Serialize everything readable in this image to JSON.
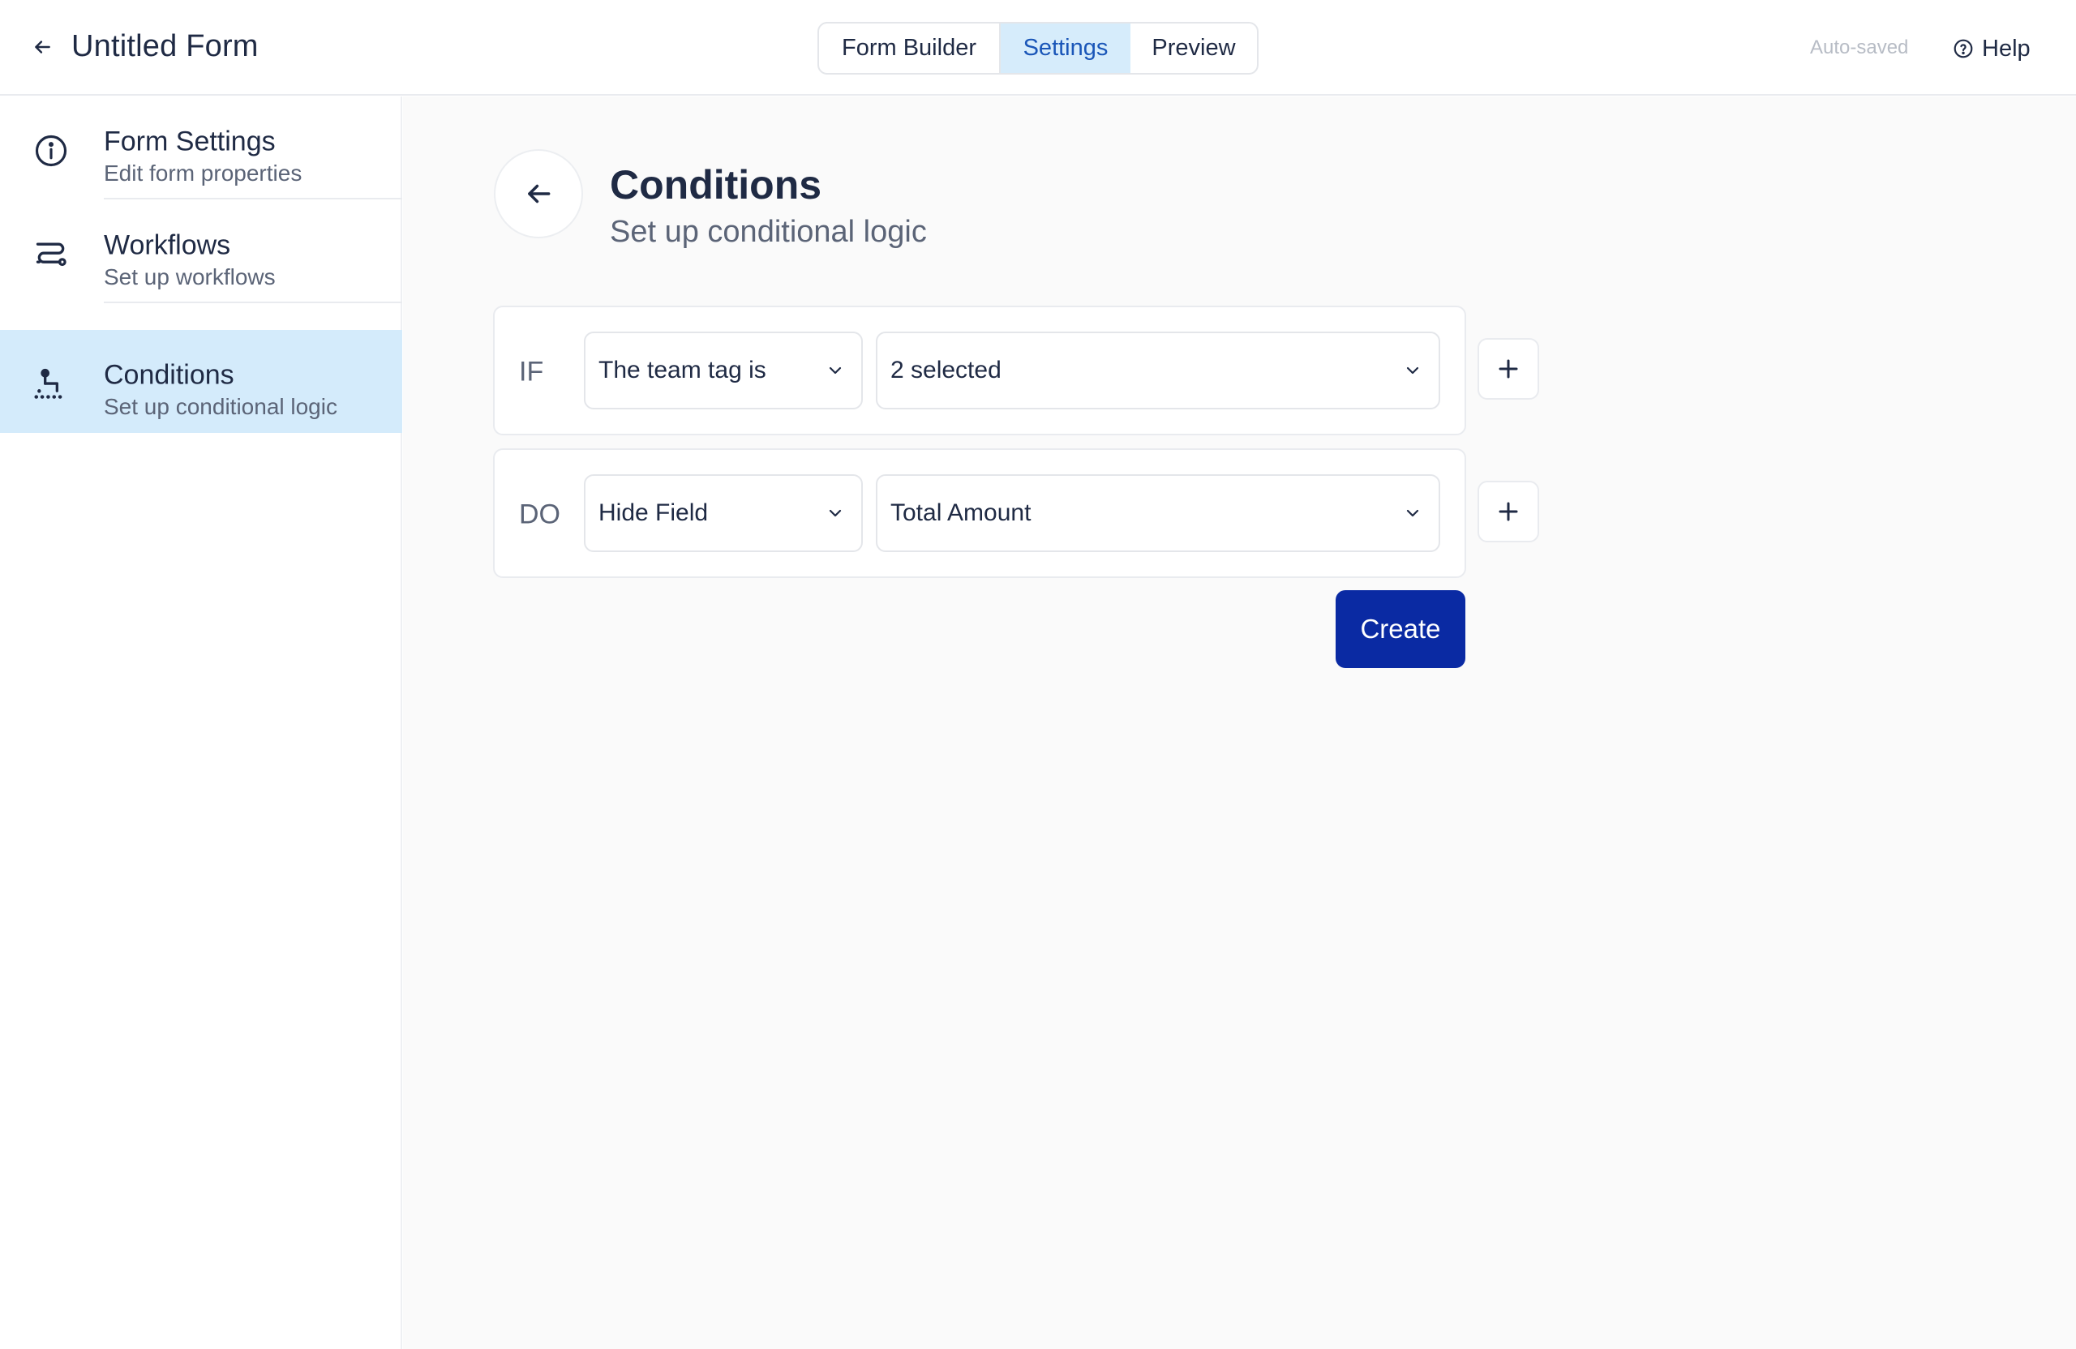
{
  "header": {
    "title": "Untitled Form",
    "tabs": [
      {
        "label": "Form Builder",
        "active": false
      },
      {
        "label": "Settings",
        "active": true
      },
      {
        "label": "Preview",
        "active": false
      }
    ],
    "status": "Auto-saved",
    "help_label": "Help"
  },
  "sidebar": {
    "items": [
      {
        "label": "Form Settings",
        "sub": "Edit form properties",
        "icon": "info-icon",
        "active": false
      },
      {
        "label": "Workflows",
        "sub": "Set up workflows",
        "icon": "workflow-icon",
        "active": false
      },
      {
        "label": "Conditions",
        "sub": "Set up conditional logic",
        "icon": "condition-icon",
        "active": true
      }
    ]
  },
  "main": {
    "title": "Conditions",
    "subtitle": "Set up conditional logic",
    "rules": [
      {
        "keyword": "IF",
        "field": "The team tag is",
        "value": "2 selected"
      },
      {
        "keyword": "DO",
        "field": "Hide Field",
        "value": "Total Amount"
      }
    ],
    "create_label": "Create"
  },
  "colors": {
    "accent": "#0a2aa3",
    "active_bg": "#d4ebfb",
    "active_text": "#1a56b8"
  }
}
